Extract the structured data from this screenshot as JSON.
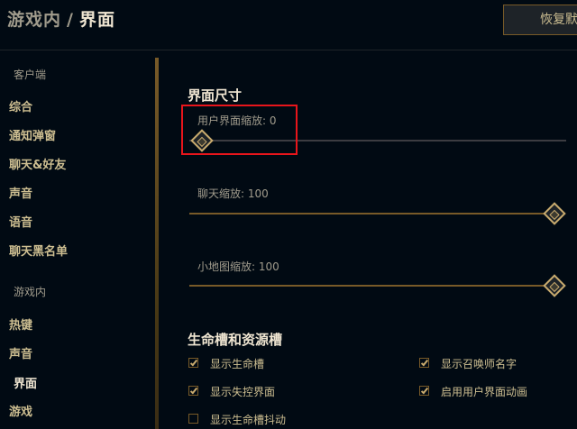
{
  "header": {
    "breadcrumb_parent": "游戏内",
    "breadcrumb_sep": "/",
    "breadcrumb_current": "界面",
    "restore_button": "恢复默"
  },
  "sidebar": {
    "group_client": "客户端",
    "client_items": [
      "综合",
      "通知弹窗",
      "聊天&好友",
      "声音",
      "语音",
      "聊天黑名单"
    ],
    "group_ingame": "游戏内",
    "ingame_items": [
      "热键",
      "声音",
      "界面",
      "游戏"
    ],
    "active_item": "界面"
  },
  "interface_size": {
    "title": "界面尺寸",
    "sliders": [
      {
        "label": "用户界面缩放: 0",
        "value": 0
      },
      {
        "label": "聊天缩放: 100",
        "value": 100
      },
      {
        "label": "小地图缩放: 100",
        "value": 100
      }
    ]
  },
  "health_bars": {
    "title": "生命槽和资源槽",
    "options": [
      {
        "label": "显示生命槽",
        "checked": true
      },
      {
        "label": "显示召唤师名字",
        "checked": true
      },
      {
        "label": "显示失控界面",
        "checked": true
      },
      {
        "label": "启用用户界面动画",
        "checked": true
      },
      {
        "label": "显示生命槽抖动",
        "checked": false
      }
    ]
  },
  "colors": {
    "gold": "#c8aa6e",
    "gold_dark": "#785a28",
    "text": "#cdbe91",
    "highlight_box": "#e8151b"
  }
}
